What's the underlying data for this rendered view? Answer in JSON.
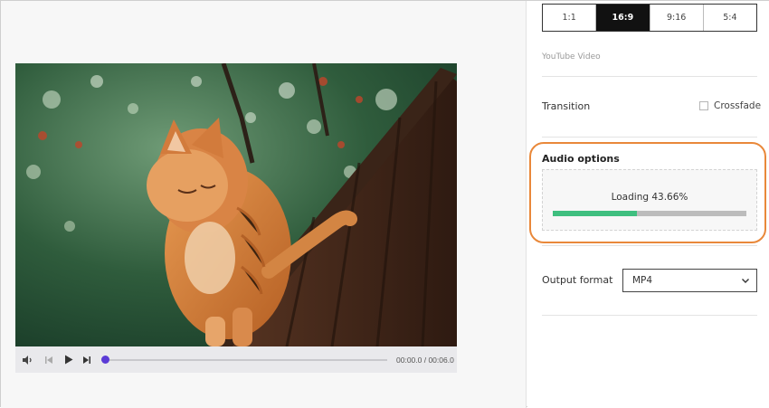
{
  "player": {
    "time_display": "00:00.0 / 00:06.0",
    "progress_fraction": 0.0
  },
  "settings": {
    "aspect_ratios": [
      "1:1",
      "16:9",
      "9:16",
      "5:4"
    ],
    "selected_ratio": "16:9",
    "preset_label": "YouTube Video",
    "transition_label": "Transition",
    "crossfade_label": "Crossfade",
    "crossfade_checked": false,
    "audio_title": "Audio options",
    "loading_text": "Loading 43.66%",
    "loading_fraction": 0.4366,
    "output_label": "Output format",
    "output_value": "MP4"
  },
  "colors": {
    "highlight": "#e9883a",
    "progress_fill": "#3fbf7f",
    "seek_knob": "#5b3bd6",
    "active_ratio_bg": "#111111"
  },
  "icons": [
    "volume-icon",
    "step-back-icon",
    "play-icon",
    "step-forward-icon",
    "chevron-down-icon",
    "cat-video-frame"
  ]
}
